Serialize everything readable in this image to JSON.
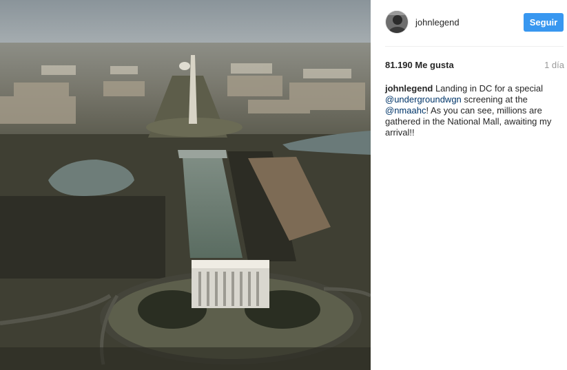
{
  "post": {
    "photo_icon": "aerial-photo-national-mall",
    "author": {
      "username": "johnlegend",
      "avatar_icon": "profile-avatar"
    },
    "follow_button": "Seguir",
    "likes": "81.190 Me gusta",
    "time": "1 día",
    "caption": {
      "user": "johnlegend",
      "text1": " Landing in DC for a special ",
      "mention1": "@undergroundwgn",
      "text2": " screening at the ",
      "mention2": "@nmaahc",
      "text3": "! As you can see, millions are gathered in the National Mall, awaiting my arrival!!"
    }
  },
  "colors": {
    "follow_button_bg": "#3897f0",
    "mention": "#003569",
    "muted": "#999999"
  }
}
